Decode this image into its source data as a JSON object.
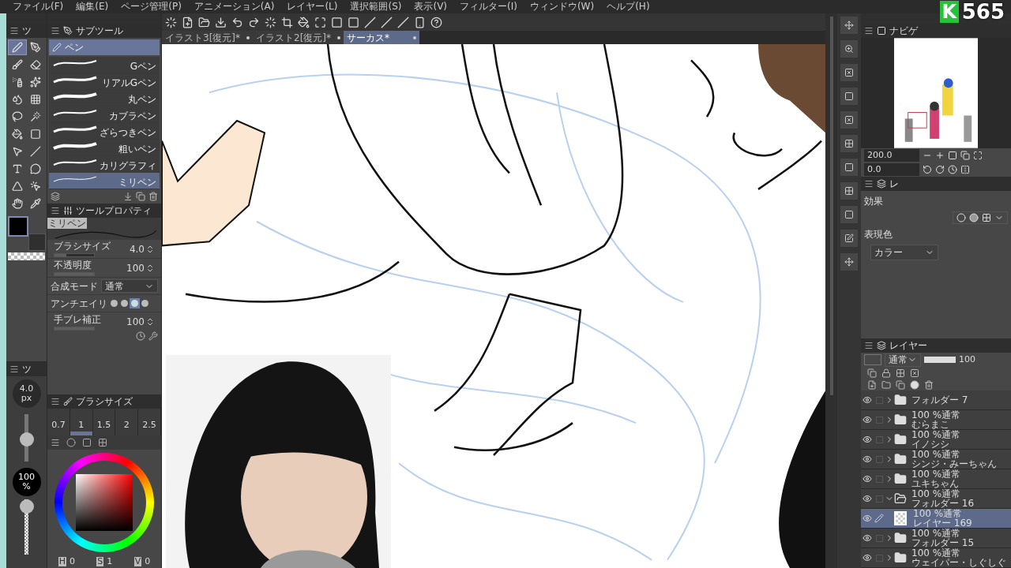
{
  "menu": [
    "ファイル(F)",
    "編集(E)",
    "ページ管理(P)",
    "アニメーション(A)",
    "レイヤー(L)",
    "選択範囲(S)",
    "表示(V)",
    "フィルター(I)",
    "ウィンドウ(W)",
    "ヘルプ(H)"
  ],
  "doc_tabs": [
    {
      "label": "イラスト3[復元]*",
      "selected": false
    },
    {
      "label": "イラスト2[復元]*",
      "selected": false
    },
    {
      "label": "サーカス*",
      "selected": true
    }
  ],
  "tool_palette": {
    "tab": "ツ",
    "tools": [
      {
        "selected": true
      },
      {
        "selected": false
      },
      {
        "selected": false
      },
      {
        "selected": false
      },
      {
        "selected": false
      },
      {
        "selected": false
      },
      {
        "selected": false
      },
      {
        "selected": false
      },
      {
        "selected": false
      },
      {
        "selected": false
      },
      {
        "selected": false
      },
      {
        "selected": false
      },
      {
        "selected": false
      },
      {
        "selected": false
      },
      {
        "selected": false
      },
      {
        "selected": false
      },
      {
        "selected": false
      },
      {
        "selected": false
      },
      {
        "selected": false
      },
      {
        "selected": false
      }
    ]
  },
  "subtool": {
    "title": "サブツール",
    "group": "ペン",
    "items": [
      {
        "label": "Gペン",
        "selected": false
      },
      {
        "label": "リアルGペン",
        "selected": false
      },
      {
        "label": "丸ペン",
        "selected": false
      },
      {
        "label": "カブラペン",
        "selected": false
      },
      {
        "label": "ざらつきペン",
        "selected": false
      },
      {
        "label": "粗いペン",
        "selected": false
      },
      {
        "label": "カリグラフィ",
        "selected": false
      },
      {
        "label": "ミリペン",
        "selected": true
      }
    ]
  },
  "tool_property": {
    "title": "ツールプロパティ",
    "preview_label": "ミリペン",
    "brush_size": {
      "label": "ブラシサイズ",
      "value": "4.0",
      "level": 0.3
    },
    "opacity": {
      "label": "不透明度",
      "value": "100",
      "level": 1
    },
    "blend": {
      "label": "合成モード",
      "value": "通常"
    },
    "antialias": {
      "label": "アンチエイリ",
      "options": [
        {
          "selected": false
        },
        {
          "selected": false
        },
        {
          "selected": true
        },
        {
          "selected": false
        }
      ]
    },
    "stabilization": {
      "label": "手ブレ補正",
      "value": "100",
      "level": 1
    }
  },
  "size_panel": {
    "tab": "ツ",
    "size": "4.0",
    "size_unit": "px",
    "size_slider": {
      "level": 0.45
    },
    "opacity": "100",
    "opacity_unit": "%",
    "opacity_slider": {
      "level": 1
    }
  },
  "brush_size_panel": {
    "title": "ブラシサイズ",
    "sizes": [
      {
        "label": "0.7",
        "selected": false
      },
      {
        "label": "1",
        "selected": true
      },
      {
        "label": "1.5",
        "selected": false
      },
      {
        "label": "2",
        "selected": false
      },
      {
        "label": "2.5",
        "selected": false
      }
    ]
  },
  "color": {
    "hsv": [
      {
        "key": "H",
        "value": "0"
      },
      {
        "key": "S",
        "value": "1"
      },
      {
        "key": "V",
        "value": "0"
      }
    ]
  },
  "navigator": {
    "title": "ナビゲ",
    "zoom": "200.0",
    "rotation": "0.0"
  },
  "layer_property": {
    "tab": "レ",
    "effect_label": "効果",
    "color_label": "表現色",
    "color_value": "カラー"
  },
  "layers_panel": {
    "title": "レイヤー",
    "blend": "通常",
    "opacity": "100",
    "opacity_slider": {
      "level": 1
    },
    "layers": [
      {
        "kind": "folder",
        "name": "フォルダー 7",
        "visible": true,
        "expanded": false,
        "selected": false
      },
      {
        "kind": "folder",
        "mode": "100 %通常",
        "name": "むらまこ",
        "visible": true,
        "expanded": false,
        "selected": false
      },
      {
        "kind": "folder",
        "mode": "100 %通常",
        "name": "イノシシ",
        "visible": true,
        "expanded": false,
        "selected": false
      },
      {
        "kind": "folder",
        "mode": "100 %通常",
        "name": "シンジ・みーちゃん",
        "visible": true,
        "expanded": false,
        "selected": false
      },
      {
        "kind": "folder",
        "mode": "100 %通常",
        "name": "ユキちゃん",
        "visible": true,
        "expanded": false,
        "selected": false
      },
      {
        "kind": "folder",
        "mode": "100 %通常",
        "name": "フォルダー 16",
        "visible": true,
        "expanded": true,
        "selected": false,
        "children": [
          {
            "kind": "raster",
            "mode": "100 %通常",
            "name": "レイヤー 169",
            "visible": true,
            "selected": true
          }
        ]
      },
      {
        "kind": "folder",
        "mode": "100 %通常",
        "name": "フォルダー 15",
        "visible": true,
        "expanded": false,
        "selected": false
      },
      {
        "kind": "folder",
        "mode": "100 %通常",
        "name": "ウェイパー・しぐしぐ",
        "visible": true,
        "expanded": false,
        "selected": false
      }
    ]
  },
  "logo": {
    "letter": "K",
    "number": "565"
  }
}
